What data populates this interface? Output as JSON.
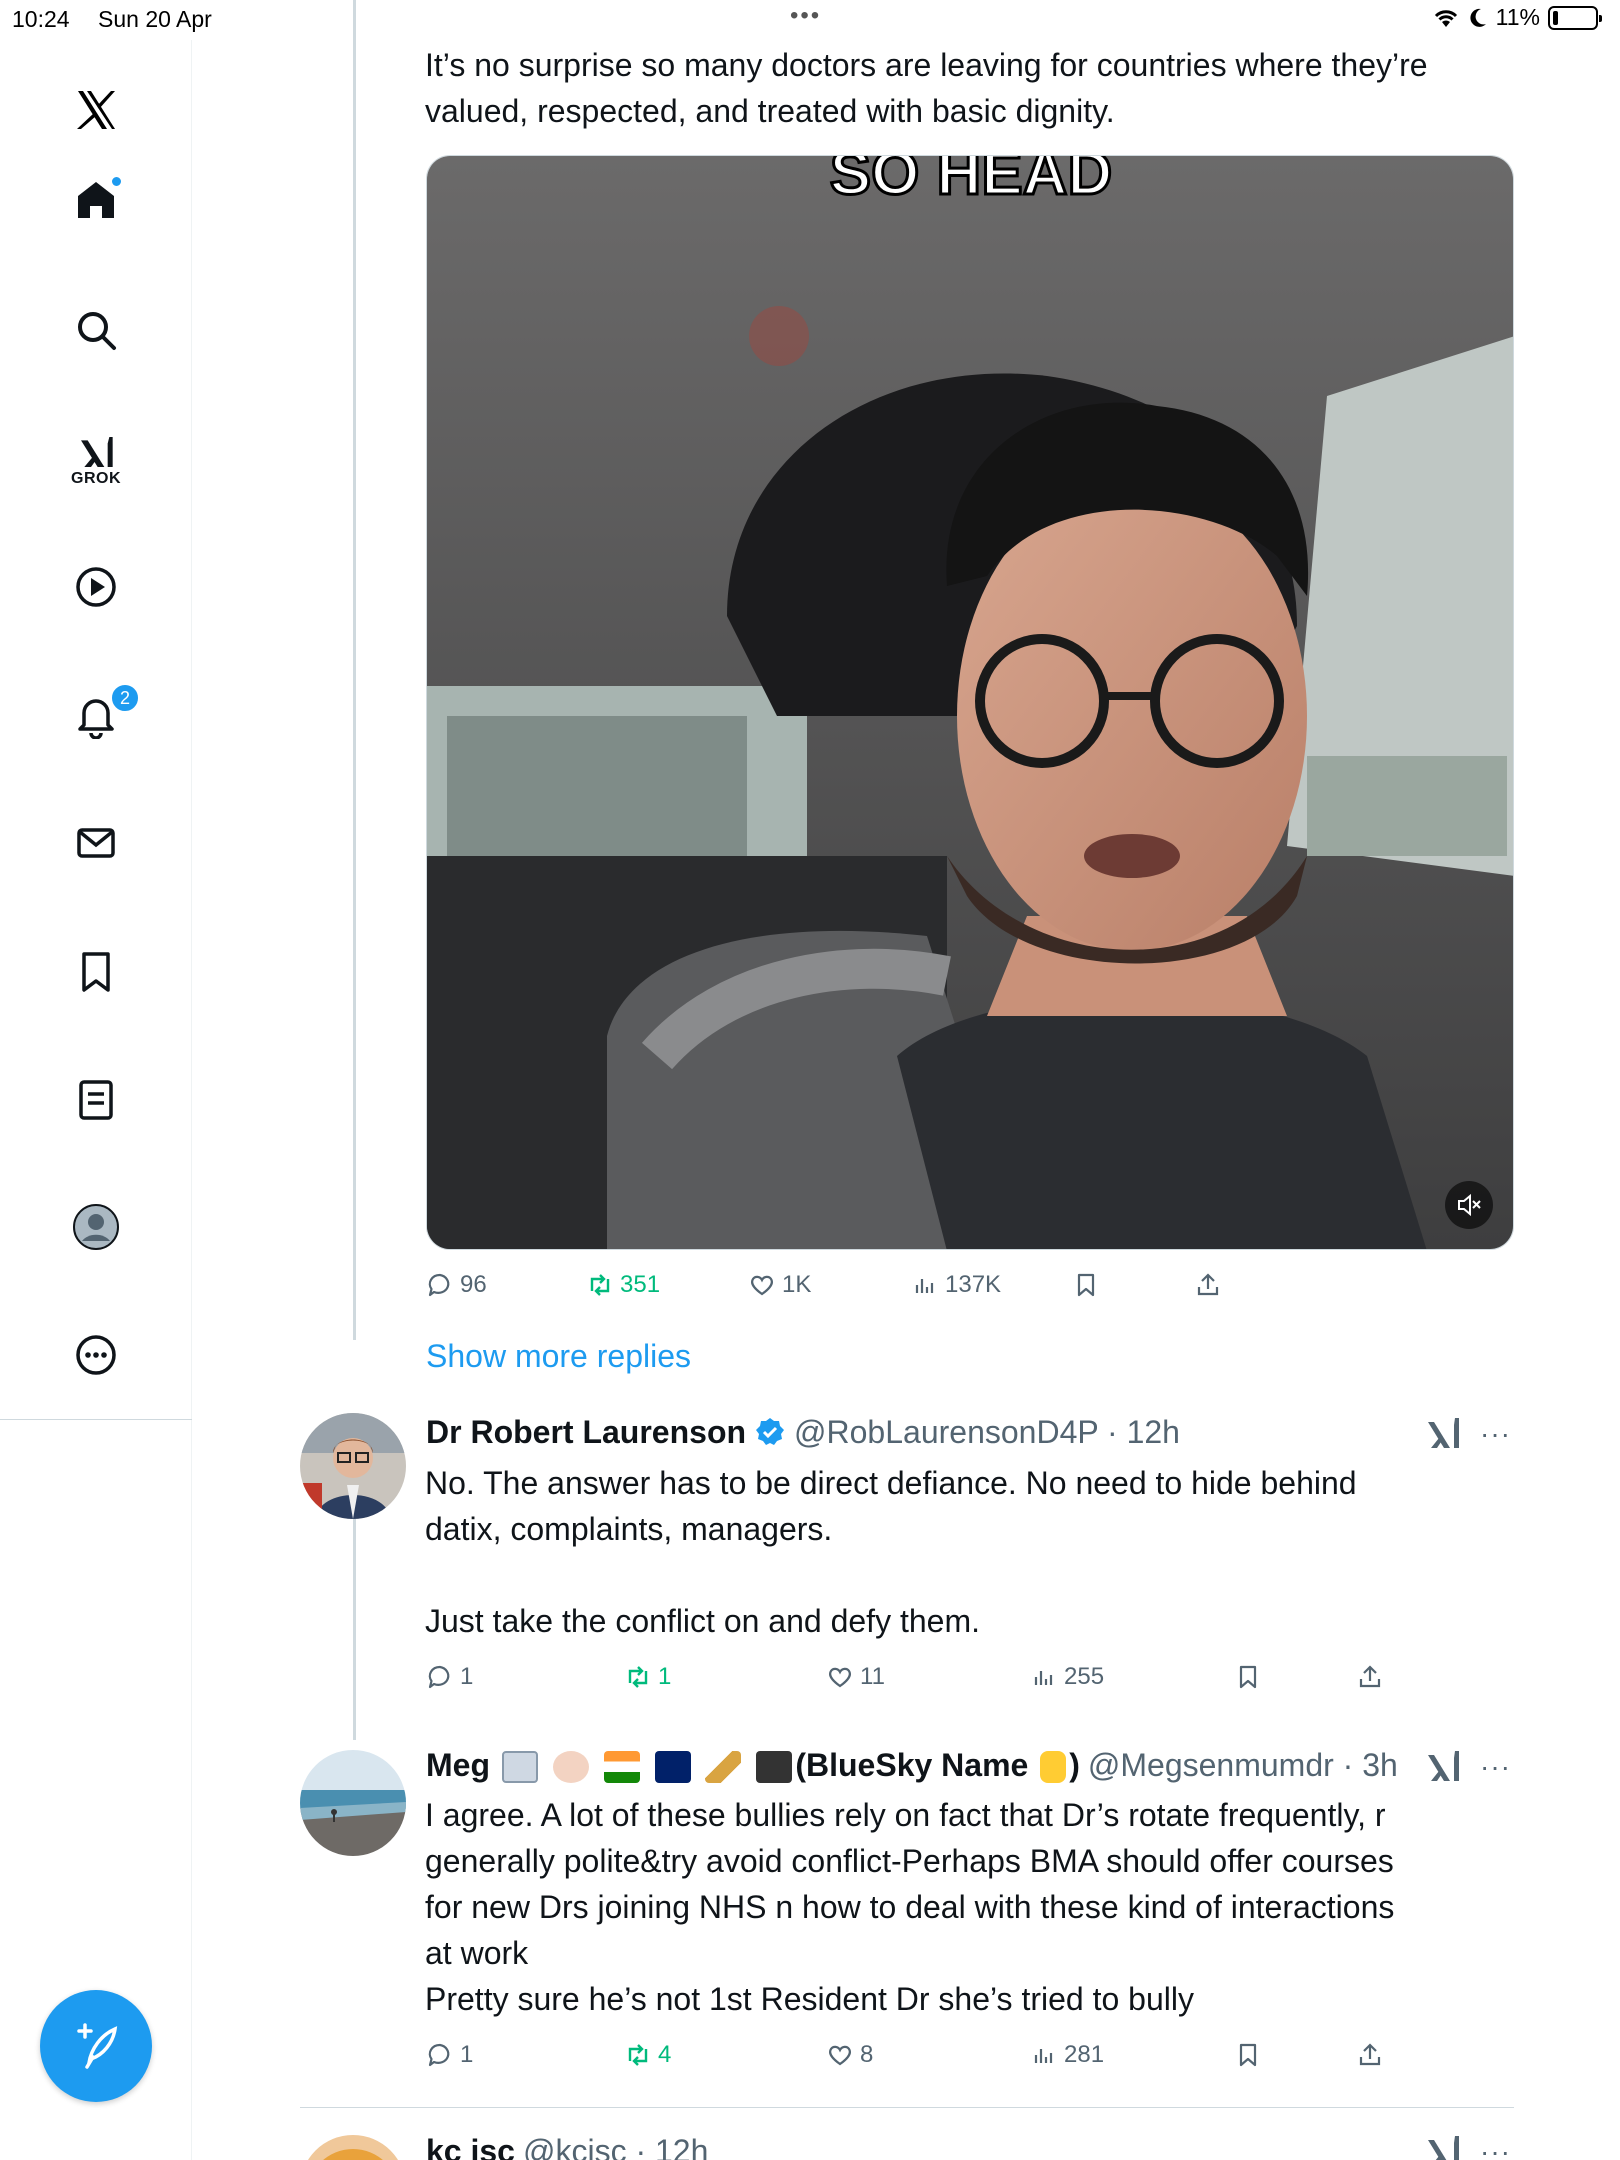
{
  "status_bar": {
    "time": "10:24",
    "date": "Sun 20 Apr",
    "battery": "11%"
  },
  "sidebar": {
    "grok_label": "GROK",
    "notifications_count": "2"
  },
  "tweet": {
    "text_line1": "It’s no surprise so many doctors are leaving for countries where they’re",
    "text_line2": "valued, respected, and treated with basic dignity.",
    "video_caption": "SO HEAD",
    "replies": "96",
    "retweets": "351",
    "likes": "1K",
    "views": "137K"
  },
  "show_more_replies": "Show more replies",
  "reply1": {
    "name": "Dr Robert Laurenson",
    "handle": "@RobLaurensonD4P · 12h",
    "line1": "No. The answer has to be direct defiance. No need to hide behind",
    "line2": "datix, complaints, managers.",
    "line3": "Just take the conflict on and defy them.",
    "replies": "1",
    "retweets": "1",
    "likes": "11",
    "views": "255"
  },
  "reply2": {
    "name_prefix": "Meg",
    "name_suffix": "(BlueSky Name",
    "name_close": ")",
    "handle": "@Megsenmumdr · 3h",
    "line1": "I agree. A lot of these bullies rely on fact that Dr’s rotate frequently, r",
    "line2": "generally polite&try avoid conflict-Perhaps BMA should offer courses",
    "line3": "for new Drs joining NHS n how to deal with these kind of interactions",
    "line4": "at work",
    "line5": "Pretty sure he’s not 1st Resident Dr she’s tried to bully",
    "replies": "1",
    "retweets": "4",
    "likes": "8",
    "views": "281"
  },
  "reply3": {
    "name": "kc isc",
    "handle": "@kcisc · 12h"
  },
  "colors": {
    "accent": "#1d9bf0",
    "retweet": "#00ba7c",
    "muted": "#536471"
  }
}
